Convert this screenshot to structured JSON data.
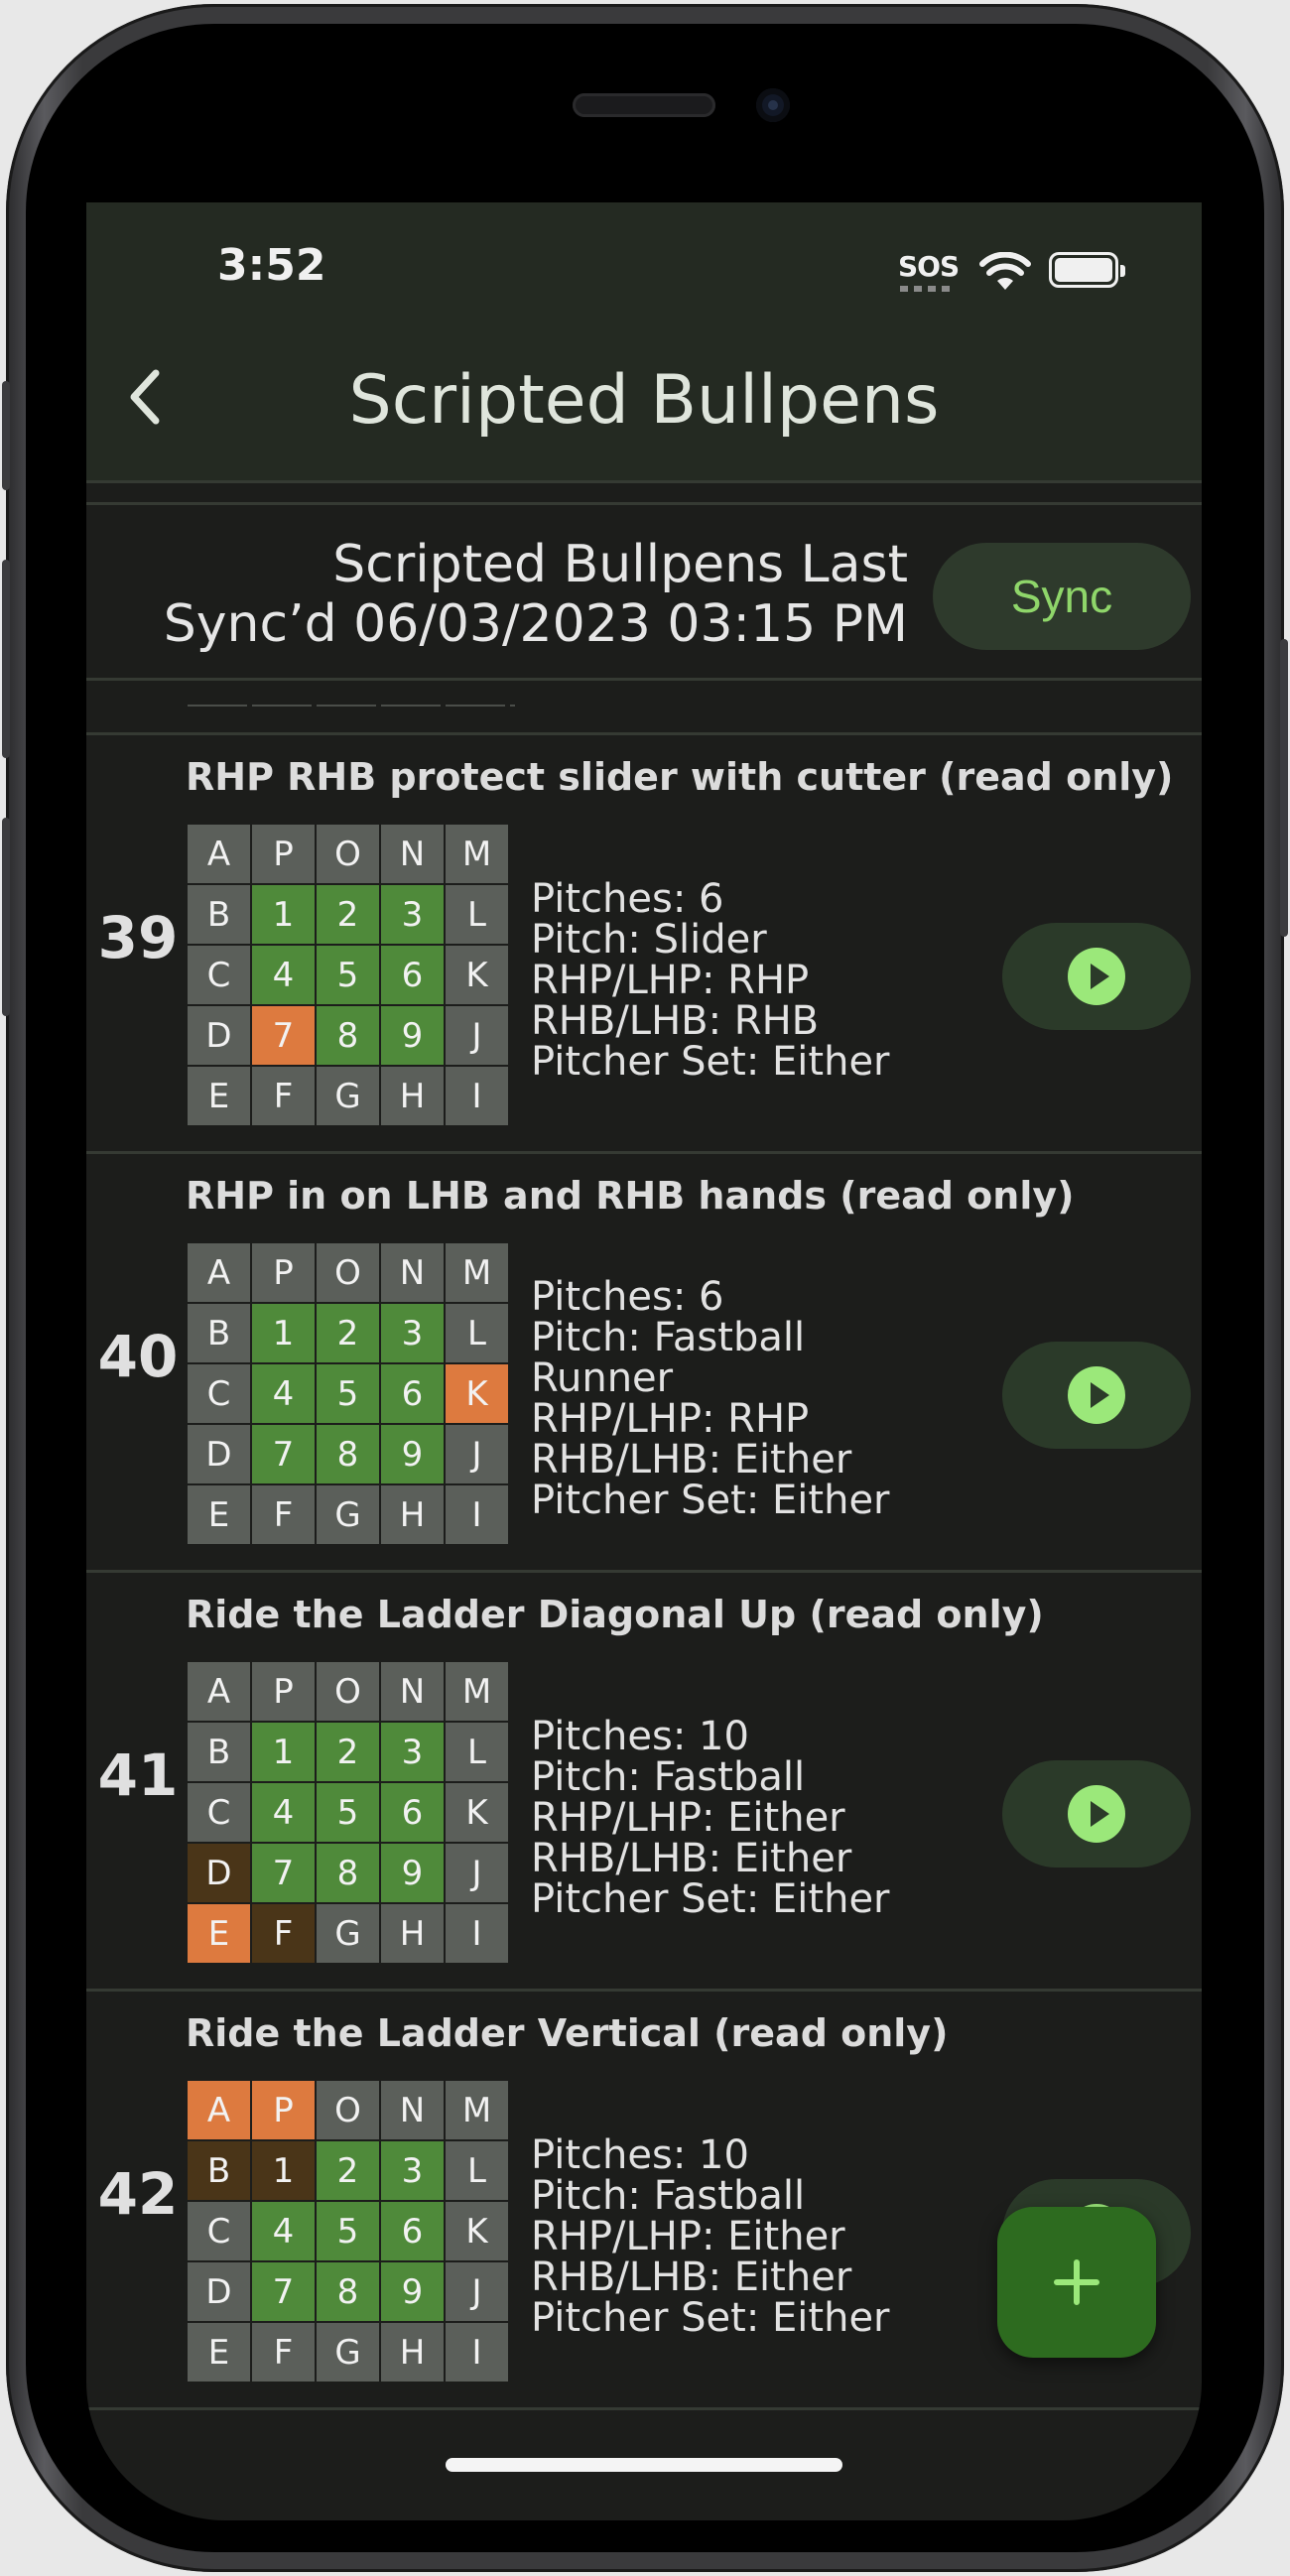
{
  "status_bar": {
    "time": "3:52",
    "sos": "SOS"
  },
  "header": {
    "title": "Scripted Bullpens"
  },
  "sync": {
    "text_line1": "Scripted Bullpens Last",
    "text_line2": "Sync’d 06/03/2023 03:15 PM",
    "button_label": "Sync"
  },
  "grid_labels": [
    [
      "A",
      "P",
      "O",
      "N",
      "M"
    ],
    [
      "B",
      "1",
      "2",
      "3",
      "L"
    ],
    [
      "C",
      "4",
      "5",
      "6",
      "K"
    ],
    [
      "D",
      "7",
      "8",
      "9",
      "J"
    ],
    [
      "E",
      "F",
      "G",
      "H",
      "I"
    ]
  ],
  "items": [
    {
      "number": "39",
      "title": "RHP RHB protect slider with cutter (read only)",
      "details": [
        "Pitches: 6",
        "Pitch: Slider",
        "RHP/LHP: RHP",
        "RHB/LHB: RHB",
        "Pitcher Set: Either"
      ],
      "highlights": {
        "hot": [
          "7"
        ],
        "dark": []
      }
    },
    {
      "number": "40",
      "title": "RHP in on LHB and RHB hands (read only)",
      "details": [
        "Pitches: 6",
        "Pitch: Fastball",
        "Runner",
        "RHP/LHP: RHP",
        "RHB/LHB: Either",
        "Pitcher Set: Either"
      ],
      "highlights": {
        "hot": [
          "K"
        ],
        "dark": []
      }
    },
    {
      "number": "41",
      "title": "Ride the Ladder Diagonal Up (read only)",
      "details": [
        "Pitches: 10",
        "Pitch: Fastball",
        "RHP/LHP: Either",
        "RHB/LHB: Either",
        "Pitcher Set: Either"
      ],
      "highlights": {
        "hot": [
          "E"
        ],
        "dark": [
          "D",
          "F"
        ]
      }
    },
    {
      "number": "42",
      "title": "Ride the Ladder Vertical (read only)",
      "details": [
        "Pitches: 10",
        "Pitch: Fastball",
        "RHP/LHP: Either",
        "RHB/LHB: Either",
        "Pitcher Set: Either"
      ],
      "highlights": {
        "hot": [
          "A",
          "P"
        ],
        "dark": [
          "B",
          "1"
        ]
      }
    }
  ],
  "fab": {
    "label": "+"
  },
  "icons": {
    "back": "chevron-left-icon",
    "play": "play-circle-icon",
    "add": "plus-icon",
    "wifi": "wifi-icon",
    "battery": "battery-icon"
  },
  "colors": {
    "accent": "#8fd66a",
    "strike_zone": "#4f8a3a",
    "outer_zone": "#5b5f5a",
    "highlight": "#dd7a3f",
    "secondary_highlight": "#4a3518"
  }
}
